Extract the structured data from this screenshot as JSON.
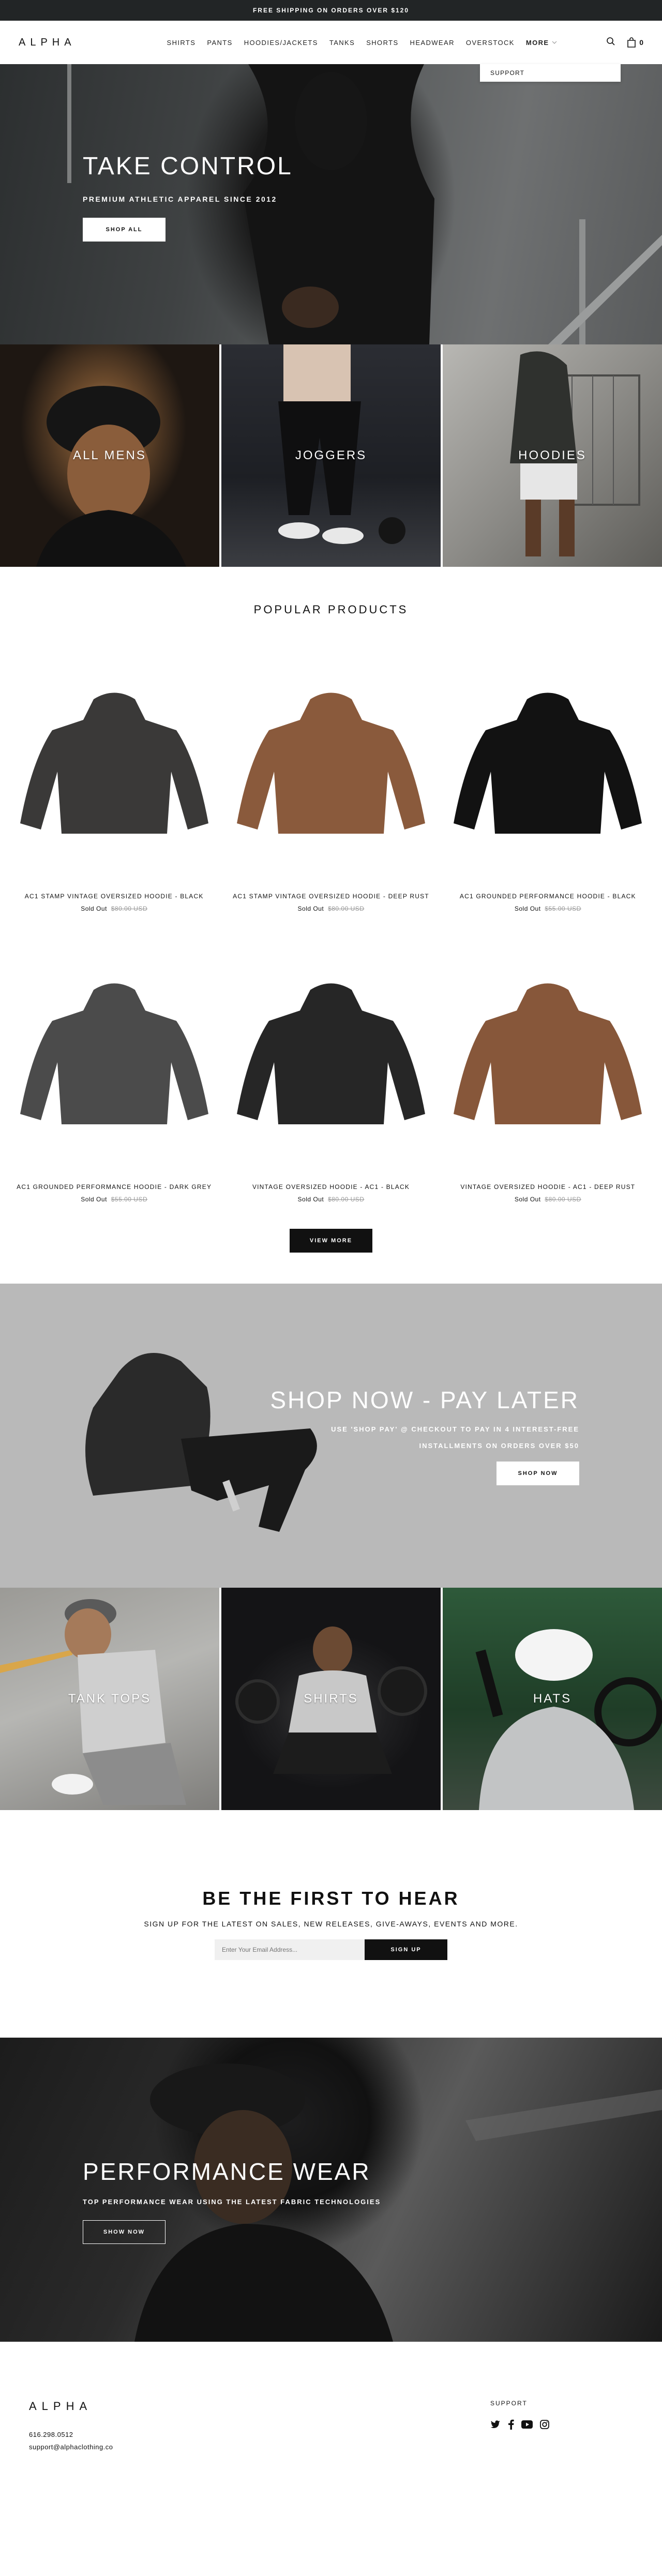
{
  "announcement": "FREE SHIPPING ON ORDERS OVER $120",
  "header": {
    "logo": "ALPHA",
    "nav": [
      "SHIRTS",
      "PANTS",
      "HOODIES/JACKETS",
      "TANKS",
      "SHORTS",
      "HEADWEAR",
      "OVERSTOCK"
    ],
    "more_label": "MORE",
    "cart_count": "0",
    "dropdown_item": "SUPPORT"
  },
  "hero": {
    "title": "TAKE CONTROL",
    "subtitle": "PREMIUM ATHLETIC APPAREL SINCE 2012",
    "button": "SHOP ALL"
  },
  "collections_top": [
    "ALL MENS",
    "JOGGERS",
    "HOODIES"
  ],
  "popular": {
    "title": "POPULAR PRODUCTS",
    "products": [
      {
        "name": "AC1 STAMP VINTAGE OVERSIZED HOODIE - BLACK",
        "status": "Sold Out",
        "price": "$80.00 USD",
        "color": "#3a3938"
      },
      {
        "name": "AC1 STAMP VINTAGE OVERSIZED HOODIE - DEEP RUST",
        "status": "Sold Out",
        "price": "$80.00 USD",
        "color": "#8a5a3c"
      },
      {
        "name": "AC1 GROUNDED PERFORMANCE HOODIE - BLACK",
        "status": "Sold Out",
        "price": "$55.00 USD",
        "color": "#121212"
      },
      {
        "name": "AC1 GROUNDED PERFORMANCE HOODIE - DARK GREY",
        "status": "Sold Out",
        "price": "$55.00 USD",
        "color": "#4b4b4b"
      },
      {
        "name": "VINTAGE OVERSIZED HOODIE - AC1 - BLACK",
        "status": "Sold Out",
        "price": "$80.00 USD",
        "color": "#262626"
      },
      {
        "name": "VINTAGE OVERSIZED HOODIE - AC1 - DEEP RUST",
        "status": "Sold Out",
        "price": "$80.00 USD",
        "color": "#87573a"
      }
    ],
    "view_more": "VIEW MORE"
  },
  "paylater": {
    "title": "SHOP NOW - PAY LATER",
    "line1": "USE 'SHOP PAY' @ CHECKOUT TO PAY IN 4 INTEREST-FREE",
    "line2": "INSTALLMENTS ON ORDERS OVER $50",
    "button": "SHOP NOW"
  },
  "collections_bottom": [
    "TANK TOPS",
    "SHIRTS",
    "HATS"
  ],
  "newsletter": {
    "title": "BE THE FIRST TO HEAR",
    "subtitle": "SIGN UP FOR THE LATEST ON SALES, NEW RELEASES, GIVE-AWAYS, EVENTS AND MORE.",
    "placeholder": "Enter Your Email Address...",
    "button": "SIGN UP"
  },
  "performance": {
    "title": "PERFORMANCE WEAR",
    "subtitle": "TOP PERFORMANCE WEAR USING THE LATEST FABRIC TECHNOLOGIES",
    "button": "SHOW NOW"
  },
  "footer": {
    "logo": "ALPHA",
    "phone": "616.298.0512",
    "email": "support@alphaclothing.co",
    "support_heading": "SUPPORT",
    "social": [
      "twitter-icon",
      "facebook-icon",
      "youtube-icon",
      "instagram-icon"
    ]
  },
  "colors": {
    "announcement_bg": "#222526",
    "paylater_bg": "#b9b9b9",
    "button_dark": "#111111"
  }
}
